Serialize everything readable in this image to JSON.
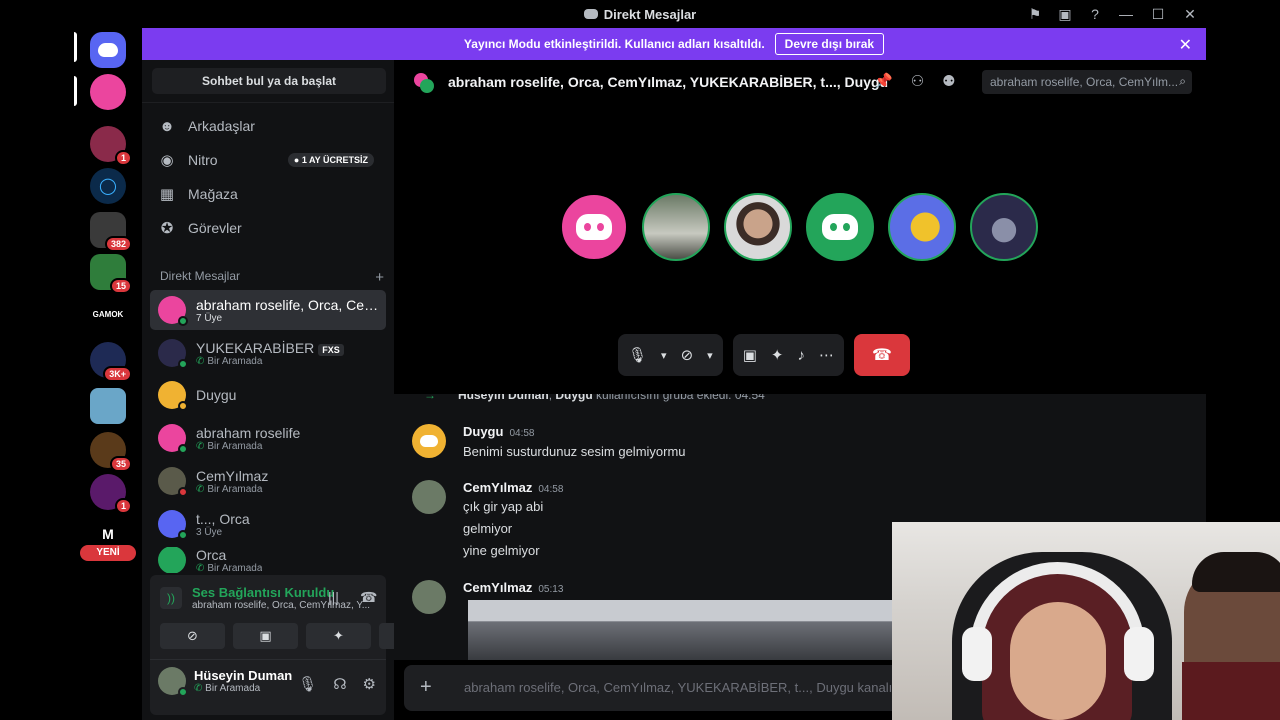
{
  "window": {
    "title": "Direkt Mesajlar"
  },
  "banner": {
    "text": "Yayıncı Modu etkinleştirildi. Kullanıcı adları kısaltıldı.",
    "button": "Devre dışı bırak"
  },
  "servers": [
    {
      "badge": "1",
      "color": "#8a2a4a"
    },
    {
      "badge": "",
      "color": "#0b2a4a"
    },
    {
      "badge": "382",
      "color": "#3a3a3a"
    },
    {
      "badge": "15",
      "color": "#2f7d3b"
    },
    {
      "label": "GAMOK",
      "badge": "",
      "color": "#000000"
    },
    {
      "badge": "3K+",
      "color": "#1e2a55"
    },
    {
      "badge": "",
      "color": "#6aa6c8"
    },
    {
      "badge": "35",
      "color": "#5a3a1a"
    },
    {
      "badge": "1",
      "color": "#5a1a6a"
    },
    {
      "label": "M",
      "badge": "",
      "color": "#000000"
    }
  ],
  "new_label": "YENİ",
  "sidebar": {
    "find": "Sohbet bul ya da başlat",
    "nav": [
      {
        "label": "Arkadaşlar"
      },
      {
        "label": "Nitro",
        "badge": "1 AY ÜCRETSİZ"
      },
      {
        "label": "Mağaza"
      },
      {
        "label": "Görevler"
      }
    ],
    "dm_header": "Direkt Mesajlar",
    "dms": [
      {
        "name": "abraham roselife, Orca, Cem...",
        "sub": "7 Üye"
      },
      {
        "name": "YUKEKARABİBER",
        "tag": "FXS",
        "sub": "Bir Aramada"
      },
      {
        "name": "Duygu",
        "sub": ""
      },
      {
        "name": "abraham roselife",
        "sub": "Bir Aramada"
      },
      {
        "name": "CemYılmaz",
        "sub": "Bir Aramada"
      },
      {
        "name": "t..., Orca",
        "sub": "3 Üye"
      },
      {
        "name": "Orca",
        "sub": "Bir Aramada"
      }
    ]
  },
  "voice": {
    "title": "Ses Bağlantısı Kuruldu",
    "sub": "abraham roselife, Orca, CemYılmaz, Y..."
  },
  "user": {
    "name": "Hüseyin Duman",
    "status": "Bir Aramada"
  },
  "header": {
    "title": "abraham roselife, Orca, CemYılmaz, YUKEKARABİBER, t..., Duygu",
    "search_placeholder": "abraham roselife, Orca, CemYılm..."
  },
  "messages": {
    "system": {
      "user1": "Hüseyin Duman",
      "user2": "Duygu",
      "text": "kullanıcısını gruba ekledi.",
      "time": "04:54"
    },
    "groups": [
      {
        "author": "Duygu",
        "time": "04:58",
        "lines": [
          "Benimi susturdunuz sesim gelmiyormu"
        ]
      },
      {
        "author": "CemYılmaz",
        "time": "04:58",
        "lines": [
          "çık gir yap abi",
          "gelmiyor",
          "yine gelmiyor"
        ]
      },
      {
        "author": "CemYılmaz",
        "time": "05:13",
        "lines": []
      }
    ]
  },
  "composer": {
    "placeholder": "abraham roselife, Orca, CemYılmaz, YUKEKARABİBER, t..., Duygu kanalına"
  }
}
